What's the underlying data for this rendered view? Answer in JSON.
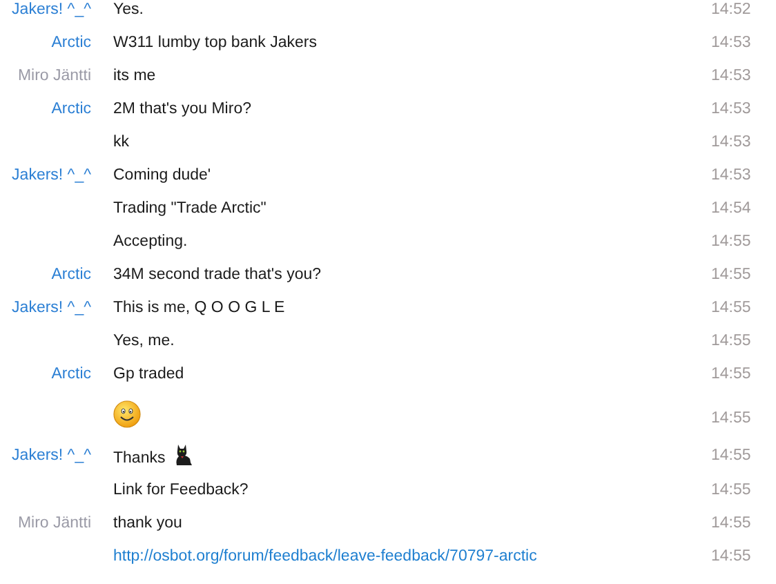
{
  "messages": [
    {
      "sender": "Jakers! ^_^",
      "color": "#2b7fd4",
      "kind": "text",
      "text": "Yes.",
      "time": "14:52"
    },
    {
      "sender": "Arctic",
      "color": "#2b7fd4",
      "kind": "text",
      "text": "W311 lumby top bank Jakers",
      "time": "14:53"
    },
    {
      "sender": "Miro Jäntti",
      "color": "#9a9aa6",
      "kind": "text",
      "text": "its me",
      "time": "14:53"
    },
    {
      "sender": "Arctic",
      "color": "#2b7fd4",
      "kind": "text",
      "text": "2M that's you Miro?",
      "time": "14:53"
    },
    {
      "kind": "text",
      "text": "kk",
      "time": "14:53"
    },
    {
      "sender": "Jakers! ^_^",
      "color": "#2b7fd4",
      "kind": "text",
      "text": "Coming dude'",
      "time": "14:53"
    },
    {
      "kind": "text",
      "text": "Trading \"Trade Arctic\"",
      "time": "14:54"
    },
    {
      "kind": "text",
      "text": "Accepting.",
      "time": "14:55"
    },
    {
      "sender": "Arctic",
      "color": "#2b7fd4",
      "kind": "text",
      "text": "34M second trade that's you?",
      "time": "14:55"
    },
    {
      "sender": "Jakers! ^_^",
      "color": "#2b7fd4",
      "kind": "text",
      "text": "This is me, Q O O  G L E",
      "time": "14:55"
    },
    {
      "kind": "text",
      "text": "Yes, me.",
      "time": "14:55"
    },
    {
      "sender": "Arctic",
      "color": "#2b7fd4",
      "kind": "text",
      "text": "Gp traded",
      "time": "14:55"
    },
    {
      "kind": "smiley",
      "time": "14:55"
    },
    {
      "sender": "Jakers! ^_^",
      "color": "#2b7fd4",
      "kind": "text_cat",
      "text": "Thanks",
      "time": "14:55"
    },
    {
      "kind": "text",
      "text": "Link for Feedback?",
      "time": "14:55"
    },
    {
      "sender": "Miro Jäntti",
      "color": "#9a9aa6",
      "kind": "text",
      "text": "thank you",
      "time": "14:55"
    },
    {
      "kind": "link",
      "text": "http://osbot.org/forum/feedback/leave-feedback/70797-arctic",
      "time": "14:55"
    }
  ]
}
